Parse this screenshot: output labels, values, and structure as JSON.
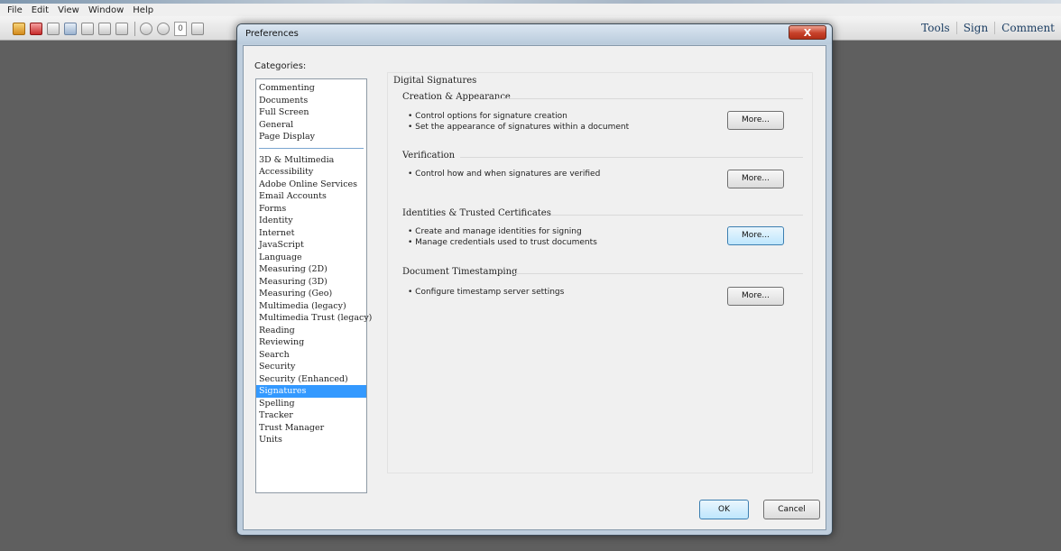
{
  "app": {
    "menu": [
      "File",
      "Edit",
      "View",
      "Window",
      "Help"
    ],
    "toolbar": {
      "page_number": "0"
    },
    "right_nav": [
      "Tools",
      "Sign",
      "Comment"
    ]
  },
  "dialog": {
    "title": "Preferences",
    "close_label": "X",
    "categories_label": "Categories:",
    "categories_top": [
      "Commenting",
      "Documents",
      "Full Screen",
      "General",
      "Page Display"
    ],
    "categories_bottom": [
      "3D & Multimedia",
      "Accessibility",
      "Adobe Online Services",
      "Email Accounts",
      "Forms",
      "Identity",
      "Internet",
      "JavaScript",
      "Language",
      "Measuring (2D)",
      "Measuring (3D)",
      "Measuring (Geo)",
      "Multimedia (legacy)",
      "Multimedia Trust (legacy)",
      "Reading",
      "Reviewing",
      "Search",
      "Security",
      "Security (Enhanced)",
      "Signatures",
      "Spelling",
      "Tracker",
      "Trust Manager",
      "Units"
    ],
    "selected_category": "Signatures",
    "panel_title": "Digital Signatures",
    "sections": [
      {
        "heading": "Creation & Appearance",
        "bullets": [
          "• Control options for signature creation",
          "• Set the appearance of signatures within a document"
        ],
        "button": "More..."
      },
      {
        "heading": "Verification",
        "bullets": [
          "• Control how and when signatures are verified"
        ],
        "button": "More..."
      },
      {
        "heading": "Identities & Trusted Certificates",
        "bullets": [
          "• Create and manage identities for signing",
          "• Manage credentials used to trust documents"
        ],
        "button": "More..."
      },
      {
        "heading": "Document Timestamping",
        "bullets": [
          "• Configure timestamp server settings"
        ],
        "button": "More..."
      }
    ],
    "ok_label": "OK",
    "cancel_label": "Cancel"
  },
  "colors": {
    "selection": "#3399ff",
    "workspace": "#5f5f5f",
    "close_button": "#c7412a"
  }
}
